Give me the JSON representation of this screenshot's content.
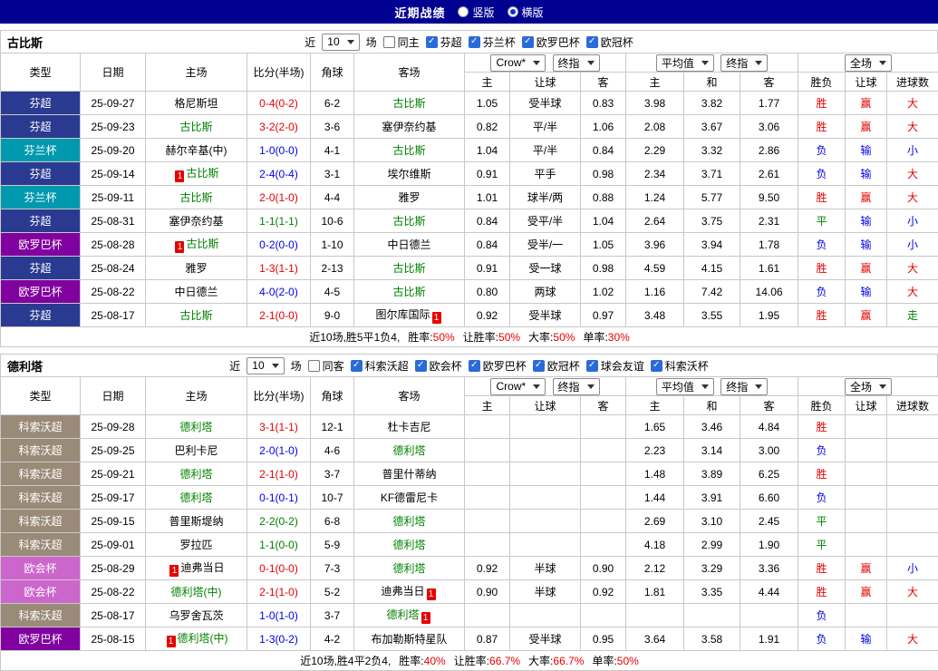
{
  "topbar": {
    "title": "近期战绩",
    "options": [
      {
        "label": "竖版",
        "selected": false
      },
      {
        "label": "横版",
        "selected": true
      }
    ]
  },
  "columns": {
    "type": "类型",
    "date": "日期",
    "home": "主场",
    "score": "比分(半场)",
    "corner": "角球",
    "away": "客场",
    "book_select": "Crow*",
    "final_select": "终指",
    "avg_select": "平均值",
    "avg_final_select": "终指",
    "scope_select": "全场",
    "sub": [
      "主",
      "让球",
      "客",
      "主",
      "和",
      "客",
      "胜负",
      "让球",
      "进球数"
    ]
  },
  "colors": {
    "navy": "#000091",
    "border": "#c9c9c9",
    "red": "#e60000",
    "blue": "#0000ee",
    "green": "#008000",
    "check": "#2b6bd9"
  },
  "type_colors": {
    "芬超": "#2b3a91",
    "芬兰杯": "#0099ae",
    "欧罗巴杯": "#8000a0",
    "科索沃超": "#9a8a78",
    "欧会杯": "#cc66cc"
  },
  "sections": [
    {
      "team": "古比斯",
      "filter": {
        "near": "近",
        "count": "10",
        "games": "场",
        "same": {
          "label": "同主",
          "checked": false
        },
        "leagues": [
          {
            "label": "芬超",
            "checked": true
          },
          {
            "label": "芬兰杯",
            "checked": true
          },
          {
            "label": "欧罗巴杯",
            "checked": true
          },
          {
            "label": "欧冠杯",
            "checked": true
          }
        ]
      },
      "rows": [
        {
          "type": "芬超",
          "date": "25-09-27",
          "home": {
            "text": "格尼斯坦"
          },
          "score": {
            "text": "0-4(0-2)",
            "color": "red"
          },
          "corner": "6-2",
          "away": {
            "text": "古比斯",
            "green": true
          },
          "odds": [
            "1.05",
            "受半球",
            "0.83"
          ],
          "avg": [
            "3.98",
            "3.82",
            "1.77"
          ],
          "res": [
            [
              "胜",
              "red"
            ],
            [
              "赢",
              "red"
            ],
            [
              "大",
              "red"
            ]
          ]
        },
        {
          "type": "芬超",
          "date": "25-09-23",
          "home": {
            "text": "古比斯",
            "green": true
          },
          "score": {
            "text": "3-2(2-0)",
            "color": "red"
          },
          "corner": "3-6",
          "away": {
            "text": "塞伊奈约基"
          },
          "odds": [
            "0.82",
            "平/半",
            "1.06"
          ],
          "avg": [
            "2.08",
            "3.67",
            "3.06"
          ],
          "res": [
            [
              "胜",
              "red"
            ],
            [
              "赢",
              "red"
            ],
            [
              "大",
              "red"
            ]
          ]
        },
        {
          "type": "芬兰杯",
          "date": "25-09-20",
          "home": {
            "text": "赫尔辛基(中)"
          },
          "score": {
            "text": "1-0(0-0)",
            "color": "blue"
          },
          "corner": "4-1",
          "away": {
            "text": "古比斯",
            "green": true
          },
          "odds": [
            "1.04",
            "平/半",
            "0.84"
          ],
          "avg": [
            "2.29",
            "3.32",
            "2.86"
          ],
          "res": [
            [
              "负",
              "blue"
            ],
            [
              "输",
              "blue"
            ],
            [
              "小",
              "blue"
            ]
          ]
        },
        {
          "type": "芬超",
          "date": "25-09-14",
          "home": {
            "text": "古比斯",
            "green": true,
            "icon": "before"
          },
          "score": {
            "text": "2-4(0-4)",
            "color": "blue"
          },
          "corner": "3-1",
          "away": {
            "text": "埃尔维斯"
          },
          "odds": [
            "0.91",
            "平手",
            "0.98"
          ],
          "avg": [
            "2.34",
            "3.71",
            "2.61"
          ],
          "res": [
            [
              "负",
              "blue"
            ],
            [
              "输",
              "blue"
            ],
            [
              "大",
              "red"
            ]
          ]
        },
        {
          "type": "芬兰杯",
          "date": "25-09-11",
          "home": {
            "text": "古比斯",
            "green": true
          },
          "score": {
            "text": "2-0(1-0)",
            "color": "red"
          },
          "corner": "4-4",
          "away": {
            "text": "雅罗"
          },
          "odds": [
            "1.01",
            "球半/两",
            "0.88"
          ],
          "avg": [
            "1.24",
            "5.77",
            "9.50"
          ],
          "res": [
            [
              "胜",
              "red"
            ],
            [
              "赢",
              "red"
            ],
            [
              "大",
              "red"
            ]
          ]
        },
        {
          "type": "芬超",
          "date": "25-08-31",
          "home": {
            "text": "塞伊奈约基"
          },
          "score": {
            "text": "1-1(1-1)",
            "color": "green"
          },
          "corner": "10-6",
          "away": {
            "text": "古比斯",
            "green": true
          },
          "odds": [
            "0.84",
            "受平/半",
            "1.04"
          ],
          "avg": [
            "2.64",
            "3.75",
            "2.31"
          ],
          "res": [
            [
              "平",
              "green"
            ],
            [
              "输",
              "blue"
            ],
            [
              "小",
              "blue"
            ]
          ]
        },
        {
          "type": "欧罗巴杯",
          "date": "25-08-28",
          "home": {
            "text": "古比斯",
            "green": true,
            "icon": "before"
          },
          "score": {
            "text": "0-2(0-0)",
            "color": "blue"
          },
          "corner": "1-10",
          "away": {
            "text": "中日德兰"
          },
          "odds": [
            "0.84",
            "受半/一",
            "1.05"
          ],
          "avg": [
            "3.96",
            "3.94",
            "1.78"
          ],
          "res": [
            [
              "负",
              "blue"
            ],
            [
              "输",
              "blue"
            ],
            [
              "小",
              "blue"
            ]
          ]
        },
        {
          "type": "芬超",
          "date": "25-08-24",
          "home": {
            "text": "雅罗"
          },
          "score": {
            "text": "1-3(1-1)",
            "color": "red"
          },
          "corner": "2-13",
          "away": {
            "text": "古比斯",
            "green": true
          },
          "odds": [
            "0.91",
            "受一球",
            "0.98"
          ],
          "avg": [
            "4.59",
            "4.15",
            "1.61"
          ],
          "res": [
            [
              "胜",
              "red"
            ],
            [
              "赢",
              "red"
            ],
            [
              "大",
              "red"
            ]
          ]
        },
        {
          "type": "欧罗巴杯",
          "date": "25-08-22",
          "home": {
            "text": "中日德兰"
          },
          "score": {
            "text": "4-0(2-0)",
            "color": "blue"
          },
          "corner": "4-5",
          "away": {
            "text": "古比斯",
            "green": true
          },
          "odds": [
            "0.80",
            "两球",
            "1.02"
          ],
          "avg": [
            "1.16",
            "7.42",
            "14.06"
          ],
          "res": [
            [
              "负",
              "blue"
            ],
            [
              "输",
              "blue"
            ],
            [
              "大",
              "red"
            ]
          ]
        },
        {
          "type": "芬超",
          "date": "25-08-17",
          "home": {
            "text": "古比斯",
            "green": true
          },
          "score": {
            "text": "2-1(0-0)",
            "color": "red"
          },
          "corner": "9-0",
          "away": {
            "text": "图尔库国际",
            "icon": "after"
          },
          "odds": [
            "0.92",
            "受半球",
            "0.97"
          ],
          "avg": [
            "3.48",
            "3.55",
            "1.95"
          ],
          "res": [
            [
              "胜",
              "red"
            ],
            [
              "赢",
              "red"
            ],
            [
              "走",
              "green"
            ]
          ]
        }
      ],
      "summary": {
        "prefix": "近10场,胜5平1负4,",
        "stats": [
          {
            "label": "胜率:",
            "value": "50%"
          },
          {
            "label": "让胜率:",
            "value": "50%"
          },
          {
            "label": "大率:",
            "value": "50%"
          },
          {
            "label": "单率:",
            "value": "30%"
          }
        ]
      }
    },
    {
      "team": "德利塔",
      "filter": {
        "near": "近",
        "count": "10",
        "games": "场",
        "same": {
          "label": "同客",
          "checked": false
        },
        "leagues": [
          {
            "label": "科索沃超",
            "checked": true
          },
          {
            "label": "欧会杯",
            "checked": true
          },
          {
            "label": "欧罗巴杯",
            "checked": true
          },
          {
            "label": "欧冠杯",
            "checked": true
          },
          {
            "label": "球会友谊",
            "checked": true
          },
          {
            "label": "科索沃杯",
            "checked": true
          }
        ]
      },
      "rows": [
        {
          "type": "科索沃超",
          "date": "25-09-28",
          "home": {
            "text": "德利塔",
            "green": true
          },
          "score": {
            "text": "3-1(1-1)",
            "color": "red"
          },
          "corner": "12-1",
          "away": {
            "text": "杜卡吉尼"
          },
          "odds": [
            "",
            "",
            ""
          ],
          "avg": [
            "1.65",
            "3.46",
            "4.84"
          ],
          "res": [
            [
              "胜",
              "red"
            ],
            [
              "",
              ""
            ],
            [
              "",
              ""
            ]
          ]
        },
        {
          "type": "科索沃超",
          "date": "25-09-25",
          "home": {
            "text": "巴利卡尼"
          },
          "score": {
            "text": "2-0(1-0)",
            "color": "blue"
          },
          "corner": "4-6",
          "away": {
            "text": "德利塔",
            "green": true
          },
          "odds": [
            "",
            "",
            ""
          ],
          "avg": [
            "2.23",
            "3.14",
            "3.00"
          ],
          "res": [
            [
              "负",
              "blue"
            ],
            [
              "",
              ""
            ],
            [
              "",
              ""
            ]
          ]
        },
        {
          "type": "科索沃超",
          "date": "25-09-21",
          "home": {
            "text": "德利塔",
            "green": true
          },
          "score": {
            "text": "2-1(1-0)",
            "color": "red"
          },
          "corner": "3-7",
          "away": {
            "text": "普里什蒂纳"
          },
          "odds": [
            "",
            "",
            ""
          ],
          "avg": [
            "1.48",
            "3.89",
            "6.25"
          ],
          "res": [
            [
              "胜",
              "red"
            ],
            [
              "",
              ""
            ],
            [
              "",
              ""
            ]
          ]
        },
        {
          "type": "科索沃超",
          "date": "25-09-17",
          "home": {
            "text": "德利塔",
            "green": true
          },
          "score": {
            "text": "0-1(0-1)",
            "color": "blue"
          },
          "corner": "10-7",
          "away": {
            "text": "KF德雷尼卡"
          },
          "odds": [
            "",
            "",
            ""
          ],
          "avg": [
            "1.44",
            "3.91",
            "6.60"
          ],
          "res": [
            [
              "负",
              "blue"
            ],
            [
              "",
              ""
            ],
            [
              "",
              ""
            ]
          ]
        },
        {
          "type": "科索沃超",
          "date": "25-09-15",
          "home": {
            "text": "普里斯堤纳"
          },
          "score": {
            "text": "2-2(0-2)",
            "color": "green"
          },
          "corner": "6-8",
          "away": {
            "text": "德利塔",
            "green": true
          },
          "odds": [
            "",
            "",
            ""
          ],
          "avg": [
            "2.69",
            "3.10",
            "2.45"
          ],
          "res": [
            [
              "平",
              "green"
            ],
            [
              "",
              ""
            ],
            [
              "",
              ""
            ]
          ]
        },
        {
          "type": "科索沃超",
          "date": "25-09-01",
          "home": {
            "text": "罗拉匹"
          },
          "score": {
            "text": "1-1(0-0)",
            "color": "green"
          },
          "corner": "5-9",
          "away": {
            "text": "德利塔",
            "green": true
          },
          "odds": [
            "",
            "",
            ""
          ],
          "avg": [
            "4.18",
            "2.99",
            "1.90"
          ],
          "res": [
            [
              "平",
              "green"
            ],
            [
              "",
              ""
            ],
            [
              "",
              ""
            ]
          ]
        },
        {
          "type": "欧会杯",
          "date": "25-08-29",
          "home": {
            "text": "迪弗当日",
            "icon": "before"
          },
          "score": {
            "text": "0-1(0-0)",
            "color": "red"
          },
          "corner": "7-3",
          "away": {
            "text": "德利塔",
            "green": true
          },
          "odds": [
            "0.92",
            "半球",
            "0.90"
          ],
          "avg": [
            "2.12",
            "3.29",
            "3.36"
          ],
          "res": [
            [
              "胜",
              "red"
            ],
            [
              "赢",
              "red"
            ],
            [
              "小",
              "blue"
            ]
          ]
        },
        {
          "type": "欧会杯",
          "date": "25-08-22",
          "home": {
            "text": "德利塔(中)",
            "green": true
          },
          "score": {
            "text": "2-1(1-0)",
            "color": "red"
          },
          "corner": "5-2",
          "away": {
            "text": "迪弗当日",
            "icon": "after"
          },
          "odds": [
            "0.90",
            "半球",
            "0.92"
          ],
          "avg": [
            "1.81",
            "3.35",
            "4.44"
          ],
          "res": [
            [
              "胜",
              "red"
            ],
            [
              "赢",
              "red"
            ],
            [
              "大",
              "red"
            ]
          ]
        },
        {
          "type": "科索沃超",
          "date": "25-08-17",
          "home": {
            "text": "乌罗舍瓦茨"
          },
          "score": {
            "text": "1-0(1-0)",
            "color": "blue"
          },
          "corner": "3-7",
          "away": {
            "text": "德利塔",
            "green": true,
            "icon": "after"
          },
          "odds": [
            "",
            "",
            ""
          ],
          "avg": [
            "",
            "",
            ""
          ],
          "res": [
            [
              "负",
              "blue"
            ],
            [
              "",
              ""
            ],
            [
              "",
              ""
            ]
          ]
        },
        {
          "type": "欧罗巴杯",
          "date": "25-08-15",
          "home": {
            "text": "德利塔(中)",
            "green": true,
            "icon": "before"
          },
          "score": {
            "text": "1-3(0-2)",
            "color": "blue"
          },
          "corner": "4-2",
          "away": {
            "text": "布加勒斯特星队"
          },
          "odds": [
            "0.87",
            "受半球",
            "0.95"
          ],
          "avg": [
            "3.64",
            "3.58",
            "1.91"
          ],
          "res": [
            [
              "负",
              "blue"
            ],
            [
              "输",
              "blue"
            ],
            [
              "大",
              "red"
            ]
          ]
        }
      ],
      "summary": {
        "prefix": "近10场,胜4平2负4,",
        "stats": [
          {
            "label": "胜率:",
            "value": "40%"
          },
          {
            "label": "让胜率:",
            "value": "66.7%"
          },
          {
            "label": "大率:",
            "value": "66.7%"
          },
          {
            "label": "单率:",
            "value": "50%"
          }
        ]
      }
    }
  ]
}
